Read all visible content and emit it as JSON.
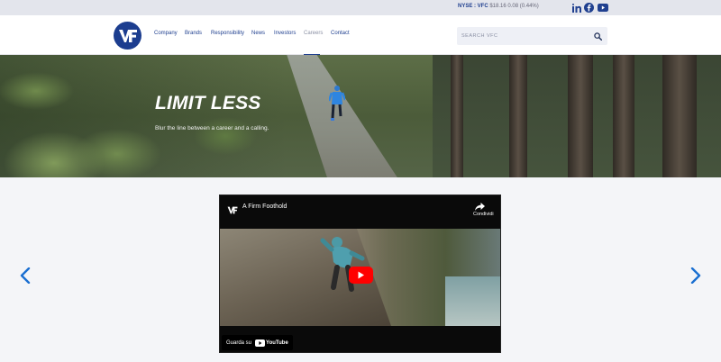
{
  "topbar": {
    "stock_ticker": "NYSE : VFC",
    "stock_price": "$18.16",
    "stock_change": "0.08",
    "stock_percent": "(0.44%)",
    "social": [
      {
        "icon": "linkedin-icon"
      },
      {
        "icon": "facebook-icon"
      },
      {
        "icon": "youtube-icon"
      }
    ]
  },
  "header": {
    "logo_text": "VF",
    "nav": [
      "Company",
      "Brands",
      "Responsibility",
      "News",
      "Investors",
      "Careers",
      "Contact"
    ],
    "active_nav": "Careers",
    "search_placeholder": "SEARCH VFC",
    "search_icon": "magnifier-icon"
  },
  "hero": {
    "title": "LIMIT LESS",
    "subtitle": "Blur the line between a career and a calling."
  },
  "video": {
    "title": "A Firm Foothold",
    "share_label": "Condividi",
    "watch_label": "Guarda su",
    "youtube_label": "YouTube"
  },
  "carousel": {
    "prev_icon": "chevron-left-icon",
    "next_icon": "chevron-right-icon"
  },
  "colors": {
    "brand_blue": "#1f3f8f",
    "youtube_red": "#ff0000",
    "arrow_blue": "#1a6fd1"
  }
}
